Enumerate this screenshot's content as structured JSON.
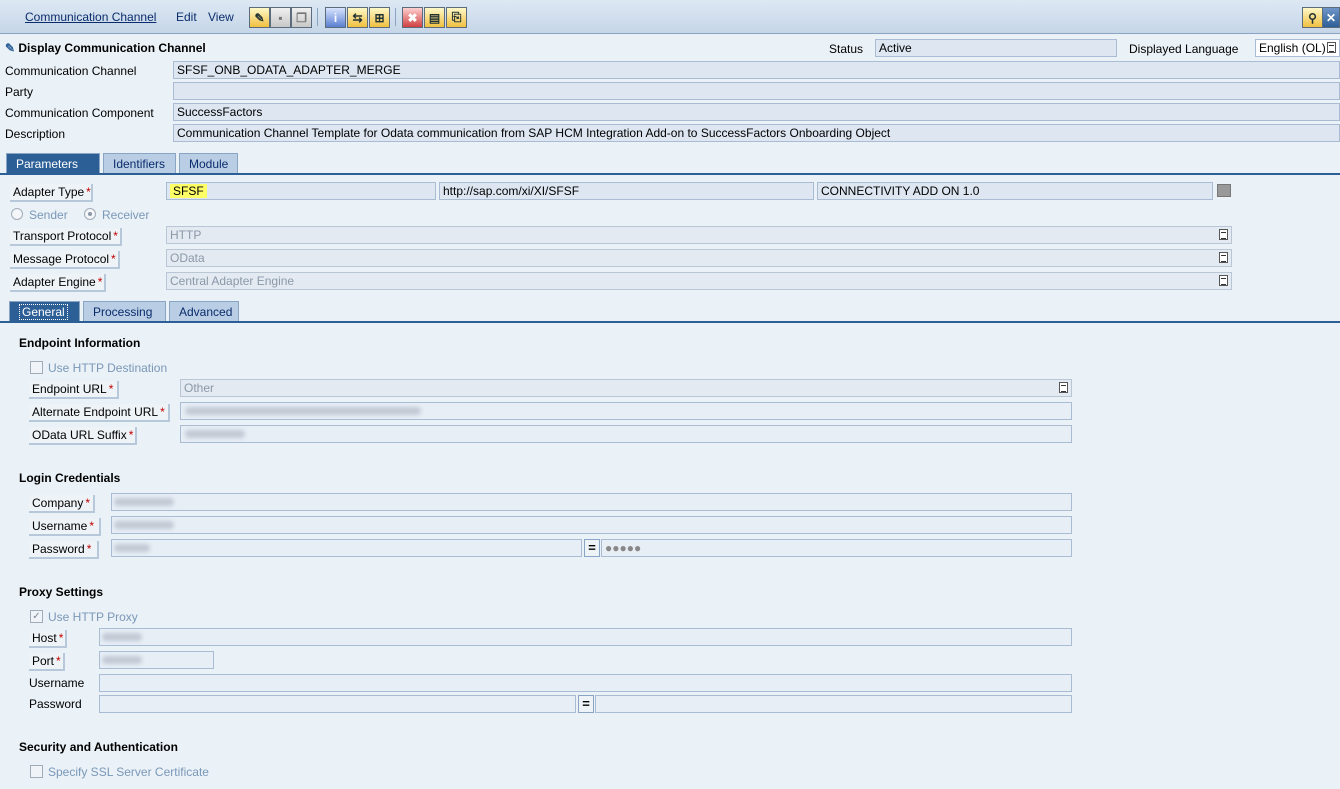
{
  "menu": {
    "communication_channel": "Communication Channel",
    "edit": "Edit",
    "view": "View"
  },
  "header": {
    "title": "Display Communication Channel",
    "status_label": "Status",
    "status_value": "Active",
    "language_label": "Displayed Language",
    "language_value": "English (OL)"
  },
  "object": {
    "channel_label": "Communication Channel",
    "channel_value": "SFSF_ONB_ODATA_ADAPTER_MERGE",
    "party_label": "Party",
    "party_value": "",
    "component_label": "Communication Component",
    "component_value": "SuccessFactors",
    "description_label": "Description",
    "description_value": "Communication Channel Template for Odata communication from SAP HCM Integration Add-on to SuccessFactors Onboarding Object"
  },
  "main_tabs": [
    "Parameters",
    "Identifiers",
    "Module"
  ],
  "parameters": {
    "adapter_type_label": "Adapter Type",
    "adapter_type_value": "SFSF",
    "adapter_namespace": "http://sap.com/xi/XI/SFSF",
    "adapter_swcv": "CONNECTIVITY ADD ON 1.0",
    "sender_label": "Sender",
    "receiver_label": "Receiver",
    "transport_protocol_label": "Transport Protocol",
    "transport_protocol_value": "HTTP",
    "message_protocol_label": "Message Protocol",
    "message_protocol_value": "OData",
    "adapter_engine_label": "Adapter Engine",
    "adapter_engine_value": "Central Adapter Engine"
  },
  "sub_tabs": [
    "General",
    "Processing",
    "Advanced"
  ],
  "endpoint": {
    "section_title": "Endpoint Information",
    "use_http_destination": "Use HTTP Destination",
    "endpoint_url_label": "Endpoint URL",
    "endpoint_url_value": "Other",
    "alternate_endpoint_label": "Alternate Endpoint URL",
    "odata_suffix_label": "OData URL Suffix"
  },
  "login": {
    "section_title": "Login Credentials",
    "company_label": "Company",
    "username_label": "Username",
    "password_label": "Password",
    "password_mask": "●●●●●"
  },
  "proxy": {
    "section_title": "Proxy Settings",
    "use_http_proxy": "Use HTTP Proxy",
    "host_label": "Host",
    "port_label": "Port",
    "username_label": "Username",
    "password_label": "Password"
  },
  "security": {
    "section_title": "Security and Authentication",
    "specify_ssl": "Specify SSL Server Certificate"
  },
  "colors": {
    "active_tab": "#2d5f97",
    "highlight": "#ffff66",
    "required": "#c00000"
  }
}
